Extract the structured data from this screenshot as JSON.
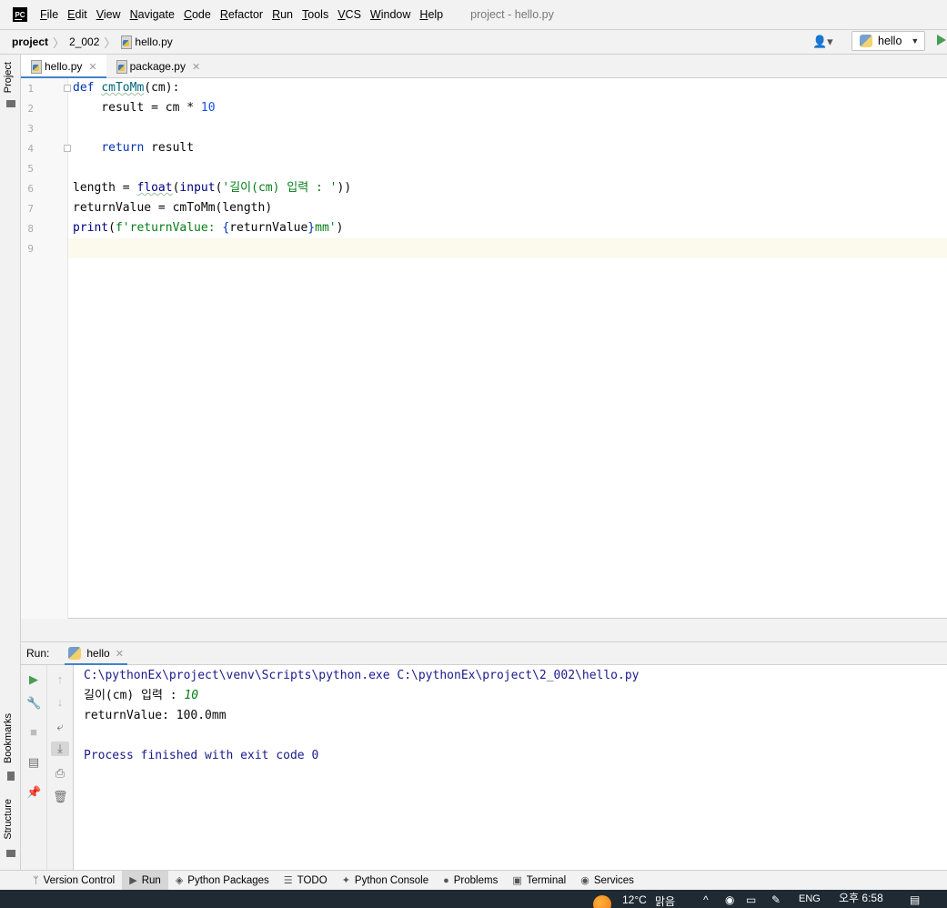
{
  "menubar": {
    "logo": "PC",
    "items": [
      {
        "u": "F",
        "rest": "ile"
      },
      {
        "u": "E",
        "rest": "dit"
      },
      {
        "u": "V",
        "rest": "iew"
      },
      {
        "u": "N",
        "rest": "avigate"
      },
      {
        "u": "C",
        "rest": "ode"
      },
      {
        "u": "R",
        "rest": "efactor"
      },
      {
        "u": "R",
        "rest": "un"
      },
      {
        "u": "T",
        "rest": "ools"
      },
      {
        "u": "V",
        "rest": "CS"
      },
      {
        "u": "W",
        "rest": "indow"
      },
      {
        "u": "H",
        "rest": "elp"
      }
    ],
    "window_title": "project - hello.py"
  },
  "navbar": {
    "crumbs": [
      "project",
      "2_002",
      "hello.py"
    ],
    "run_config": "hello"
  },
  "left_strip": {
    "project_tab": "Project",
    "bookmarks_tab": "Bookmarks",
    "structure_tab": "Structure"
  },
  "editor_tabs": [
    {
      "label": "hello.py",
      "active": true
    },
    {
      "label": "package.py",
      "active": false
    }
  ],
  "editor": {
    "line_numbers": [
      "1",
      "2",
      "3",
      "4",
      "5",
      "6",
      "7",
      "8",
      "9"
    ],
    "lines": [
      "def cmToMm(cm):",
      "    result = cm * 10",
      "",
      "    return result",
      "",
      "length = float(input('길이(cm) 입력 : '))",
      "returnValue = cmToMm(length)",
      "print(f'returnValue: {returnValue}mm')",
      ""
    ],
    "code": {
      "l1": {
        "kw": "def",
        "fn": "cmToMm",
        "rest": "(cm):"
      },
      "l2": {
        "pre": "    result = cm * ",
        "num": "10"
      },
      "l4": {
        "indent": "    ",
        "kw": "return",
        "rest": " result"
      },
      "l6": {
        "pre": "length = ",
        "b1": "float",
        "p1": "(",
        "b2": "input",
        "p2": "(",
        "str": "'길이(cm) 입력 : '",
        "post": "))"
      },
      "l7": {
        "text": "returnValue = cmToMm(length)"
      },
      "l8": {
        "b1": "print",
        "p1": "(",
        "s1": "f'returnValue: ",
        "br1": "{",
        "var": "returnValue",
        "br2": "}",
        "s2": "mm'",
        "post": ")"
      }
    }
  },
  "run_panel": {
    "label": "Run:",
    "tab": "hello",
    "console": {
      "command": "C:\\pythonEx\\project\\venv\\Scripts\\python.exe C:\\pythonEx\\project\\2_002\\hello.py",
      "prompt": "길이(cm) 입력 : ",
      "input": "10",
      "output": "returnValue: 100.0mm",
      "exit": "Process finished with exit code 0"
    }
  },
  "bottom_tools": [
    {
      "label": "Version Control",
      "icon": "branch-icon"
    },
    {
      "label": "Run",
      "icon": "run-icon"
    },
    {
      "label": "Python Packages",
      "icon": "packages-icon"
    },
    {
      "label": "TODO",
      "icon": "todo-icon"
    },
    {
      "label": "Python Console",
      "icon": "python-console-icon"
    },
    {
      "label": "Problems",
      "icon": "problems-icon"
    },
    {
      "label": "Terminal",
      "icon": "terminal-icon"
    },
    {
      "label": "Services",
      "icon": "services-icon"
    }
  ],
  "taskbar": {
    "temperature": "12°C",
    "weather": "맑음",
    "lang": "ENG",
    "time": "오후 6:58"
  }
}
